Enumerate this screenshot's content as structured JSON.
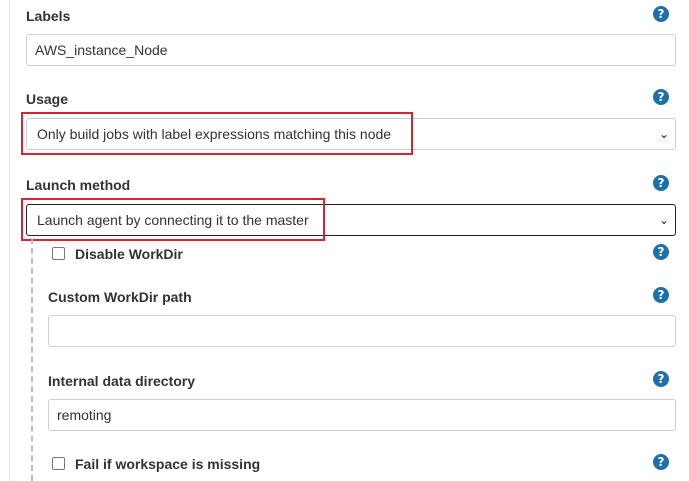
{
  "labels_section": {
    "label": "Labels",
    "value": "AWS_instance_Node"
  },
  "usage_section": {
    "label": "Usage",
    "selected": "Only build jobs with label expressions matching this node"
  },
  "launch_section": {
    "label": "Launch method",
    "selected": "Launch agent by connecting it to the master"
  },
  "disable_workdir": {
    "label": "Disable WorkDir",
    "checked": false
  },
  "custom_workdir": {
    "label": "Custom WorkDir path",
    "value": ""
  },
  "internal_data": {
    "label": "Internal data directory",
    "value": "remoting"
  },
  "fail_workspace": {
    "label": "Fail if workspace is missing",
    "checked": false
  },
  "help_glyph": "?",
  "chevron_glyph": "⌄",
  "colors": {
    "help": "#1f6fa8",
    "highlight": "#d9232f"
  }
}
